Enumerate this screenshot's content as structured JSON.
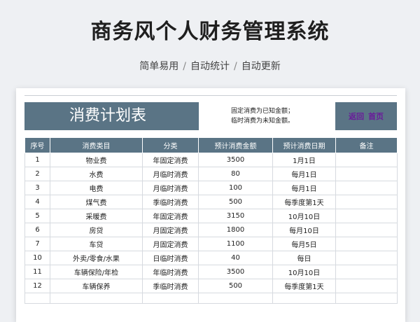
{
  "hero": {
    "title": "商务风个人财务管理系统",
    "sub1": "简单易用",
    "sub2": "自动统计",
    "sub3": "自动更新",
    "separator": "/"
  },
  "sheet": {
    "banner": "消费计划表",
    "note_line1": "固定消费为已知金额；",
    "note_line2": "临时消费为未知金额。",
    "nav_back": "返回",
    "nav_home": "首页"
  },
  "table": {
    "headers": [
      "序号",
      "消费类目",
      "分类",
      "预计消费金额",
      "预计消费日期",
      "备注"
    ],
    "rows": [
      [
        "1",
        "物业费",
        "年固定消费",
        "3500",
        "1月1日",
        ""
      ],
      [
        "2",
        "水费",
        "月临时消费",
        "80",
        "每月1日",
        ""
      ],
      [
        "3",
        "电费",
        "月临时消费",
        "100",
        "每月1日",
        ""
      ],
      [
        "4",
        "煤气费",
        "季临时消费",
        "500",
        "每季度第1天",
        ""
      ],
      [
        "5",
        "采暖费",
        "年固定消费",
        "3150",
        "10月10日",
        ""
      ],
      [
        "6",
        "房贷",
        "月固定消费",
        "1800",
        "每月10日",
        ""
      ],
      [
        "7",
        "车贷",
        "月固定消费",
        "1100",
        "每月5日",
        ""
      ],
      [
        "10",
        "外卖/零食/水果",
        "日临时消费",
        "40",
        "每日",
        ""
      ],
      [
        "11",
        "车辆保险/年检",
        "年临时消费",
        "3500",
        "10月10日",
        ""
      ],
      [
        "12",
        "车辆保养",
        "季临时消费",
        "500",
        "每季度第1天",
        ""
      ]
    ]
  },
  "colors": {
    "header_bg": "#5a7485",
    "nav_link": "#6a1b9a",
    "page_bg": "#eef0f3"
  }
}
